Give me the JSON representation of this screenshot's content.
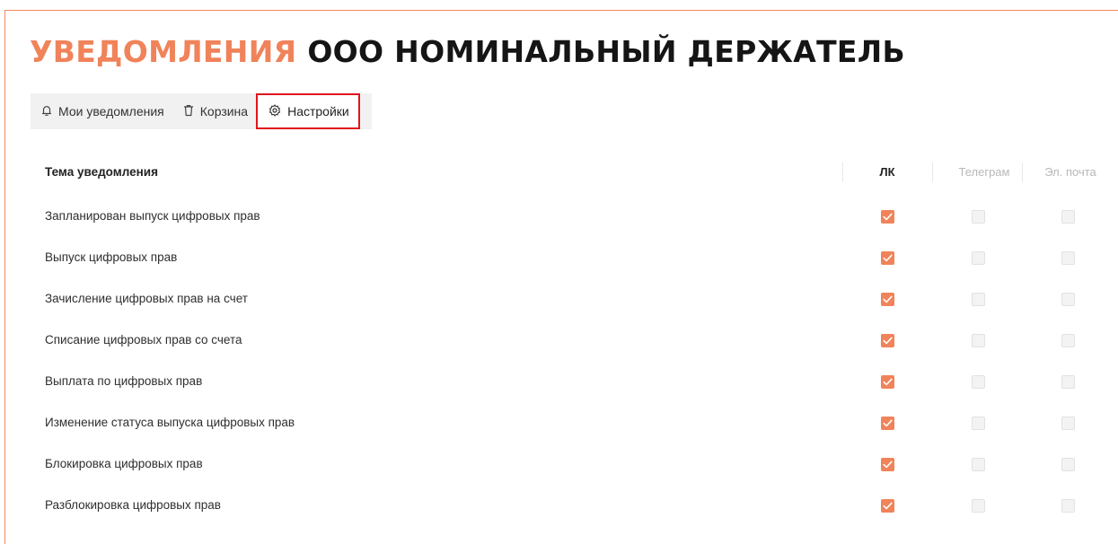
{
  "header": {
    "title_accent": "УВЕДОМЛЕНИЯ",
    "title_org": "ООО НОМИНАЛЬНЫЙ ДЕРЖАТЕЛЬ"
  },
  "tabs": [
    {
      "label": "Мои уведомления",
      "icon": "bell-icon",
      "active": false
    },
    {
      "label": "Корзина",
      "icon": "trash-icon",
      "active": false
    },
    {
      "label": "Настройки",
      "icon": "gear-icon",
      "active": true
    }
  ],
  "table": {
    "headers": {
      "topic": "Тема уведомления",
      "lk": "ЛК",
      "telegram": "Телеграм",
      "email": "Эл. почта"
    },
    "rows": [
      {
        "label": "Запланирован выпуск цифровых прав",
        "lk": true,
        "telegram": false,
        "email": false
      },
      {
        "label": "Выпуск цифровых прав",
        "lk": true,
        "telegram": false,
        "email": false
      },
      {
        "label": "Зачисление цифровых прав на счет",
        "lk": true,
        "telegram": false,
        "email": false
      },
      {
        "label": "Списание цифровых прав со счета",
        "lk": true,
        "telegram": false,
        "email": false
      },
      {
        "label": "Выплата по цифровых прав",
        "lk": true,
        "telegram": false,
        "email": false
      },
      {
        "label": "Изменение статуса выпуска цифровых прав",
        "lk": true,
        "telegram": false,
        "email": false
      },
      {
        "label": "Блокировка цифровых прав",
        "lk": true,
        "telegram": false,
        "email": false
      },
      {
        "label": "Разблокировка цифровых прав",
        "lk": true,
        "telegram": false,
        "email": false
      }
    ]
  },
  "colors": {
    "accent": "#f0835a",
    "highlight": "#e0141e"
  }
}
